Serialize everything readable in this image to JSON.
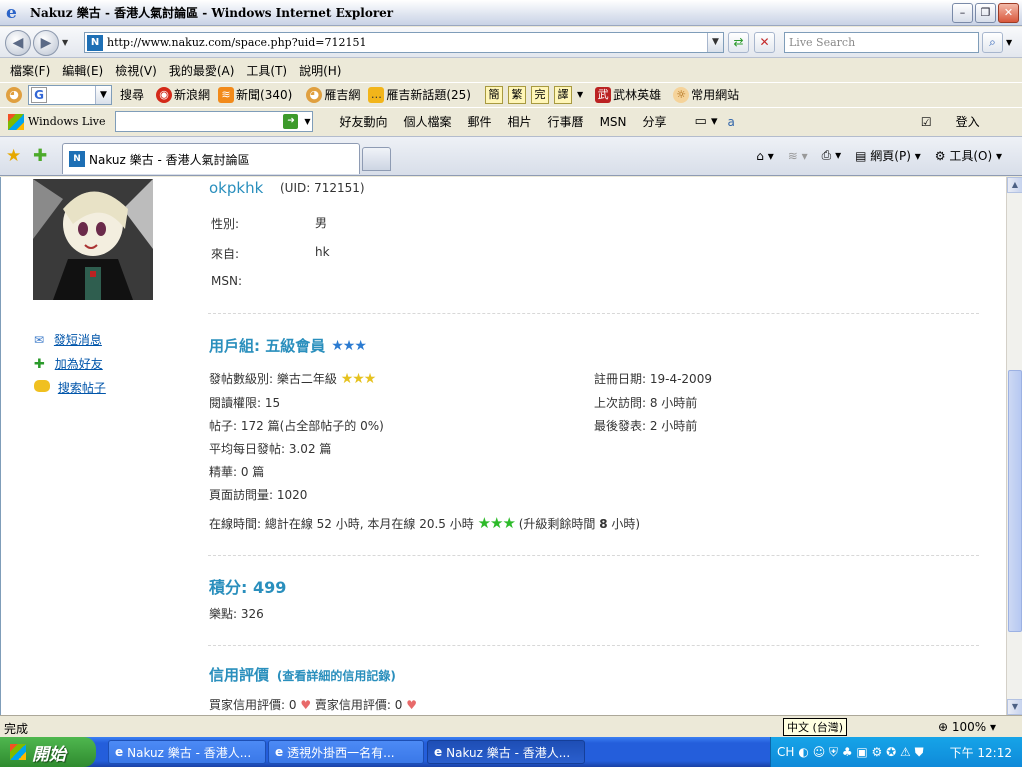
{
  "window": {
    "title": "Nakuz 樂古 - 香港人氣討論區 - Windows Internet Explorer"
  },
  "address": {
    "url": "http://www.nakuz.com/space.php?uid=712151",
    "live_search_placeholder": "Live Search"
  },
  "menu": [
    "檔案(F)",
    "編輯(E)",
    "檢視(V)",
    "我的最愛(A)",
    "工具(T)",
    "說明(H)"
  ],
  "toolbar1": {
    "search_label": "搜尋",
    "sina": "新浪網",
    "news": "新聞(340)",
    "gorgeous": "雁吉網",
    "topics": "雁吉新話題(25)",
    "chinese": [
      "簡",
      "繁",
      "完",
      "譯"
    ],
    "wulin": "武林英雄",
    "common": "常用網站"
  },
  "toolbar2": {
    "brand": "Windows Live",
    "links": [
      "好友動向",
      "個人檔案",
      "郵件",
      "相片",
      "行事曆",
      "MSN",
      "分享"
    ],
    "signin": "登入"
  },
  "tabs": {
    "active": "Nakuz 樂古 - 香港人氣討論區"
  },
  "cmdbar": {
    "page": "網頁(P)",
    "tools": "工具(O)"
  },
  "profile": {
    "username": "okpkhk",
    "uid": "(UID: 712151)",
    "fields": [
      {
        "label": "性別:",
        "value": "男"
      },
      {
        "label": "來自:",
        "value": "hk"
      },
      {
        "label": "MSN:",
        "value": ""
      }
    ],
    "actions": [
      "發短消息",
      "加為好友",
      "搜索帖子"
    ],
    "group_title": "用戶組: 五級會員",
    "stats_left": [
      "發帖數級別: 樂古二年級",
      "閱讀權限: 15",
      "帖子: 172 篇(占全部帖子的 0%)",
      "平均每日發帖: 3.02 篇",
      "精華: 0 篇",
      "頁面訪問量: 1020"
    ],
    "stats_right": [
      "註冊日期: 19-4-2009",
      "上次訪問: 8 小時前",
      "最後發表: 2 小時前"
    ],
    "online_text": "在線時間: 總計在線 52 小時, 本月在線 20.5 小時",
    "online_upgrade_pre": "(升級剩餘時間 ",
    "online_upgrade_num": "8",
    "online_upgrade_post": " 小時)",
    "score_title": "積分: 499",
    "points": "樂點: 326",
    "credit_title": "信用評價",
    "credit_link": "(查看詳細的信用記錄)",
    "buyer": "買家信用評價: 0",
    "seller": "賣家信用評價: 0"
  },
  "status": {
    "text": "完成",
    "ime": "中文 (台灣)",
    "zoom": "100%"
  },
  "taskbar": {
    "start": "開始",
    "items": [
      "Nakuz 樂古 - 香港人...",
      "透視外掛西一名有...",
      "Nakuz 樂古 - 香港人..."
    ],
    "lang": "CH",
    "clock": "下午 12:12"
  }
}
